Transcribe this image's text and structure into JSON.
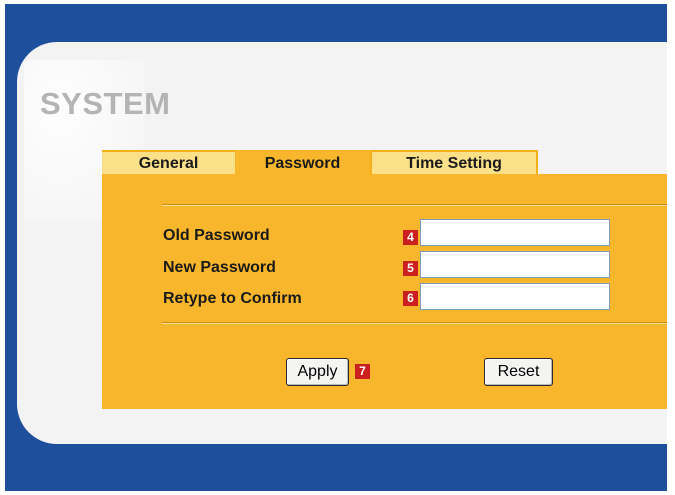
{
  "page": {
    "title": "SYSTEM"
  },
  "tabs": [
    {
      "label": "General",
      "active": false
    },
    {
      "label": "Password",
      "active": true
    },
    {
      "label": "Time Setting",
      "active": false
    }
  ],
  "form": {
    "fields": [
      {
        "label": "Old Password",
        "badge": "4",
        "value": ""
      },
      {
        "label": "New Password",
        "badge": "5",
        "value": ""
      },
      {
        "label": "Retype to Confirm",
        "badge": "6",
        "value": ""
      }
    ],
    "apply_label": "Apply",
    "apply_badge": "7",
    "reset_label": "Reset"
  },
  "colors": {
    "frame": "#1e4f9c",
    "panel": "#f3f3f3",
    "content": "#f8b62c",
    "inactive_tab": "#fbe08a",
    "title": "#b4b4b4",
    "badge": "#cc2020"
  }
}
